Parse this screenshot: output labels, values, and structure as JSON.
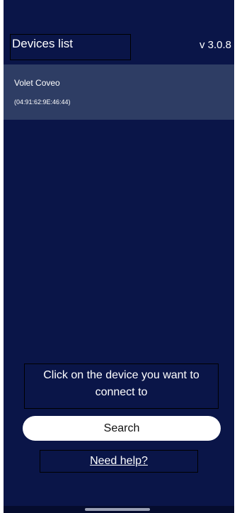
{
  "header": {
    "title": "Devices list",
    "version": "v 3.0.8"
  },
  "devices": [
    {
      "name": "Volet Coveo",
      "mac": "(04:91:62:9E:46:44)"
    }
  ],
  "footer": {
    "instruction": "Click on the device you want to connect to",
    "search_label": "Search",
    "help_label": "Need help?"
  },
  "colors": {
    "background": "#0a1548",
    "device_row": "#2e3d64",
    "button": "#ffffff"
  }
}
